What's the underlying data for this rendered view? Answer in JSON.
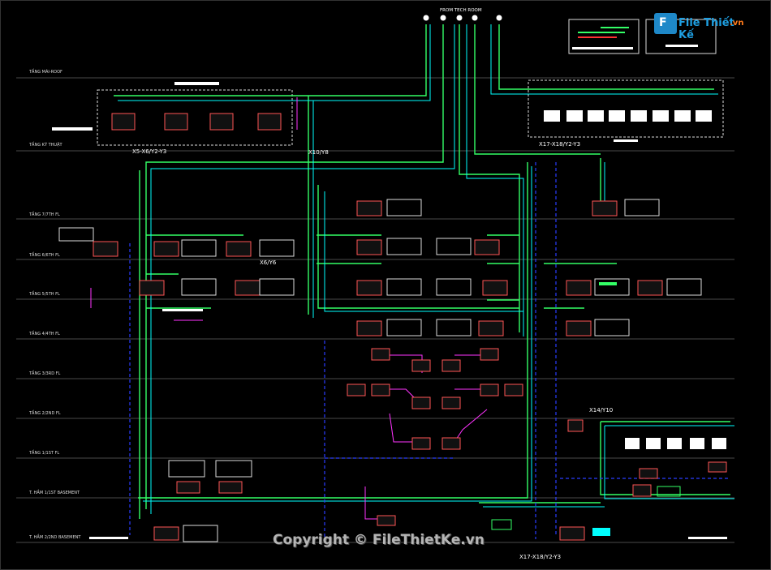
{
  "header": {
    "source_label": "FROM TECH ROOM"
  },
  "levels": [
    {
      "label": "TẦNG MÁI-ROOF"
    },
    {
      "label": "TẦNG KỸ THUẬT"
    },
    {
      "label": "TẦNG 7/7TH FL"
    },
    {
      "label": "TẦNG 6/6TH FL"
    },
    {
      "label": "TẦNG 5/5TH FL"
    },
    {
      "label": "TẦNG 4/4TH FL"
    },
    {
      "label": "TẦNG 3/3RD FL"
    },
    {
      "label": "TẦNG 2/2ND FL"
    },
    {
      "label": "TẦNG 1/1ST FL"
    },
    {
      "label": "T. HẦM 1/1ST BASEMENT"
    },
    {
      "label": "T. HẦM 2/2ND BASEMENT"
    }
  ],
  "annotations": {
    "left_group": "X5-X6/Y2-Y3",
    "center_riser": "X10/Y8",
    "left_riser": "X6/Y6",
    "right_group": "X17-X18/Y2-Y3",
    "right_low": "X14/Y10",
    "bottom": "X17-X18/Y2-Y3"
  },
  "watermark": {
    "text": "Copyright © FileThietKe.vn"
  },
  "logo": {
    "icon_letter": "F",
    "name": "File Thiết Kế",
    "suffix": ".vn"
  },
  "colors": {
    "pipe_main": "#33ff66",
    "pipe_supply": "#00ffff",
    "pipe_riser": "#2a3dff",
    "branch": "#ff33ff",
    "unit": "#ff5555",
    "grid": "#555555"
  }
}
